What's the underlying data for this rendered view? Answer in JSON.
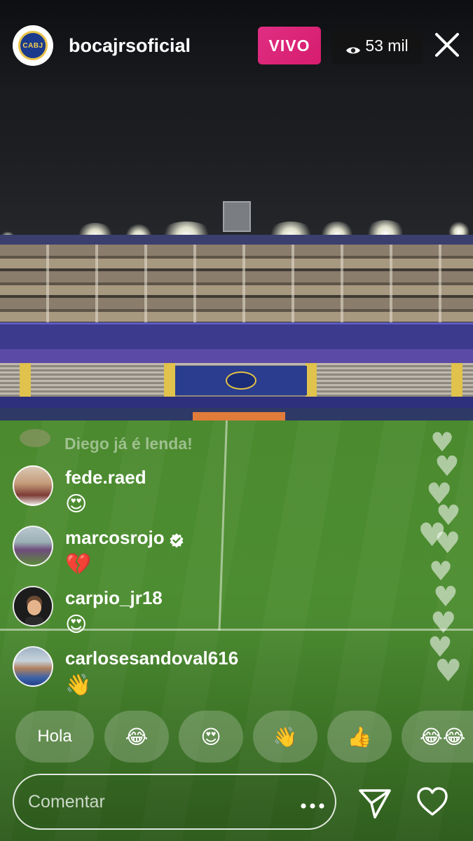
{
  "header": {
    "account_username": "bocajrsoficial",
    "avatar_crest_text": "CABJ",
    "live_label": "VIVO",
    "viewer_count": "53 mil",
    "icons": {
      "viewers": "eye-icon",
      "close": "close-icon"
    }
  },
  "comments": {
    "faded": {
      "text": "Diego já é lenda!"
    },
    "items": [
      {
        "username": "fede.raed",
        "text": "😍",
        "verified": false
      },
      {
        "username": "marcosrojo",
        "text": "💔",
        "verified": true
      },
      {
        "username": "carpio_jr18",
        "text": "😍",
        "verified": false
      },
      {
        "username": "carlosesandoval616",
        "text": "👋",
        "verified": false
      }
    ]
  },
  "quick_replies": [
    {
      "label": "Hola"
    },
    {
      "label": "😂"
    },
    {
      "label": "😍"
    },
    {
      "label": "👋"
    },
    {
      "label": "👍"
    },
    {
      "label": "😂😂"
    }
  ],
  "footer": {
    "comment_placeholder": "Comentar",
    "icons": {
      "more": "more-options-icon",
      "send": "send-icon",
      "like": "heart-icon"
    }
  },
  "colors": {
    "live_badge": "#d91f73",
    "pitch_green": "#4b8a2e",
    "pill_background": "rgba(210,215,200,0.28)"
  }
}
